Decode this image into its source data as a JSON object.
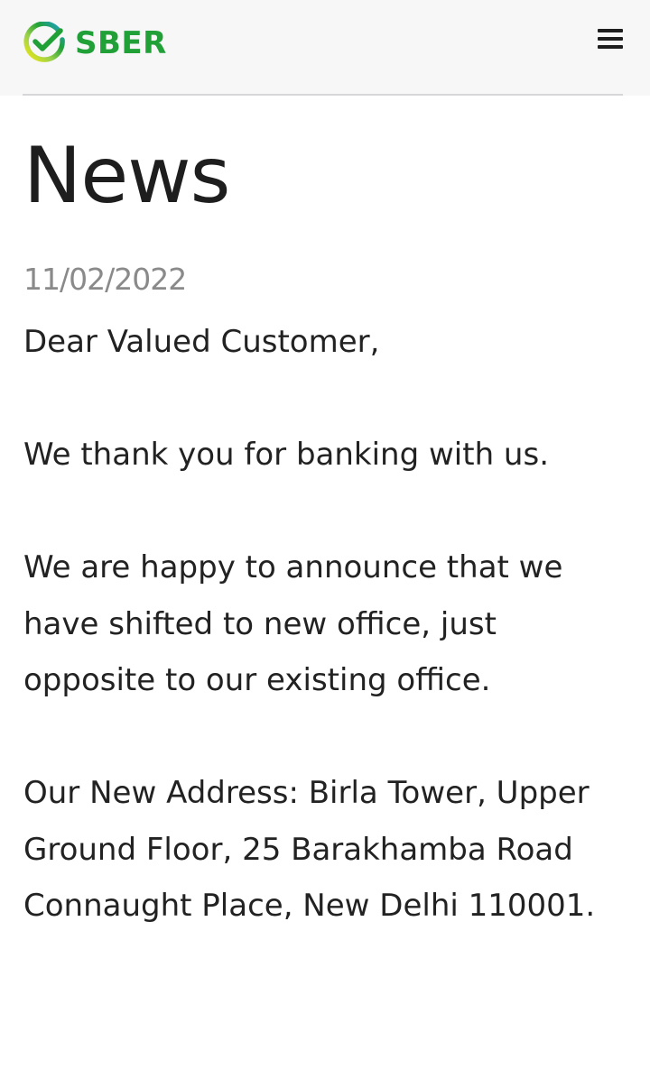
{
  "header": {
    "brand": "SBER",
    "logo_icon": "sber-checkmark-icon",
    "menu_icon": "hamburger-menu-icon",
    "brand_color": "#21a038"
  },
  "main": {
    "title": "News",
    "date": "11/02/2022",
    "greeting": "Dear Valued Customer,",
    "paragraphs": [
      "We thank you for banking with us.",
      "We are happy to announce that we have shifted to new office, just opposite to our existing office.",
      "Our New Address: Birla Tower, Upper Ground Floor, 25 Barakhamba Road Connaught Place, New Delhi 110001."
    ]
  }
}
